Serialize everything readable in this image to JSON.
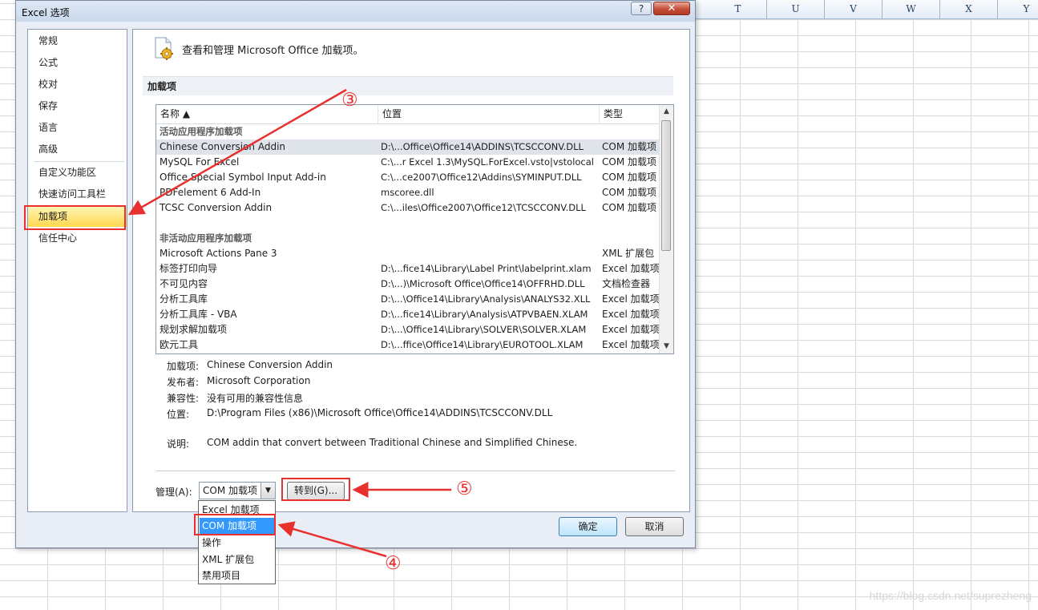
{
  "spreadsheet": {
    "columns": [
      "T",
      "U",
      "V",
      "W",
      "X",
      "Y"
    ],
    "watermark": "https://blog.csdn.net/suprezheng"
  },
  "dialog": {
    "title": "Excel 选项",
    "help_label": "?",
    "close_label": "✕",
    "nav": {
      "items": [
        "常规",
        "公式",
        "校对",
        "保存",
        "语言",
        "高级",
        "自定义功能区",
        "快速访问工具栏",
        "加载项",
        "信任中心"
      ],
      "selected": "加载项"
    },
    "heading": "查看和管理 Microsoft Office 加载项。",
    "section_title": "加载项",
    "list": {
      "columns": {
        "name": "名称 ▲",
        "location": "位置",
        "type": "类型"
      },
      "active_group": "活动应用程序加载项",
      "active": [
        {
          "name": "Chinese Conversion Addin",
          "location": "D:\\...Office\\Office14\\ADDINS\\TCSCCONV.DLL",
          "type": "COM 加载项"
        },
        {
          "name": "MySQL For Excel",
          "location": "C:\\...r Excel 1.3\\MySQL.ForExcel.vsto|vstolocal",
          "type": "COM 加载项"
        },
        {
          "name": "Office Special Symbol Input Add-in",
          "location": "C:\\...ce2007\\Office12\\Addins\\SYMINPUT.DLL",
          "type": "COM 加载项"
        },
        {
          "name": "PDFelement 6 Add-In",
          "location": "mscoree.dll",
          "type": "COM 加载项"
        },
        {
          "name": "TCSC Conversion Addin",
          "location": "C:\\...iles\\Office2007\\Office12\\TCSCCONV.DLL",
          "type": "COM 加载项"
        }
      ],
      "inactive_group": "非活动应用程序加载项",
      "inactive": [
        {
          "name": "Microsoft Actions Pane 3",
          "location": "",
          "type": "XML 扩展包"
        },
        {
          "name": "标签打印向导",
          "location": "D:\\...fice14\\Library\\Label Print\\labelprint.xlam",
          "type": "Excel 加载项"
        },
        {
          "name": "不可见内容",
          "location": "D:\\...)\\Microsoft Office\\Office14\\OFFRHD.DLL",
          "type": "文档检查器"
        },
        {
          "name": "分析工具库",
          "location": "D:\\...\\Office14\\Library\\Analysis\\ANALYS32.XLL",
          "type": "Excel 加载项"
        },
        {
          "name": "分析工具库 - VBA",
          "location": "D:\\...fice14\\Library\\Analysis\\ATPVBAEN.XLAM",
          "type": "Excel 加载项"
        },
        {
          "name": "规划求解加载项",
          "location": "D:\\...\\Office14\\Library\\SOLVER\\SOLVER.XLAM",
          "type": "Excel 加载项"
        },
        {
          "name": "欧元工具",
          "location": "D:\\...ffice\\Office14\\Library\\EUROTOOL.XLAM",
          "type": "Excel 加载项"
        }
      ],
      "selected_row": "Chinese Conversion Addin"
    },
    "details": {
      "addin_label": "加载项:",
      "addin_value": "Chinese Conversion Addin",
      "publisher_label": "发布者:",
      "publisher_value": "Microsoft Corporation",
      "compat_label": "兼容性:",
      "compat_value": "没有可用的兼容性信息",
      "location_label": "位置:",
      "location_value": "D:\\Program Files (x86)\\Microsoft Office\\Office14\\ADDINS\\TCSCCONV.DLL",
      "desc_label": "说明:",
      "desc_value": "COM addin that convert between Traditional Chinese and Simplified Chinese."
    },
    "manage": {
      "label": "管理(A):",
      "selected": "COM 加载项",
      "options": [
        "Excel 加载项",
        "COM 加载项",
        "操作",
        "XML 扩展包",
        "禁用项目"
      ],
      "goto_label": "转到(G)..."
    },
    "ok_label": "确定",
    "cancel_label": "取消"
  },
  "annotations": {
    "markers": [
      "③",
      "④",
      "⑤"
    ],
    "color": "#e8312e"
  }
}
